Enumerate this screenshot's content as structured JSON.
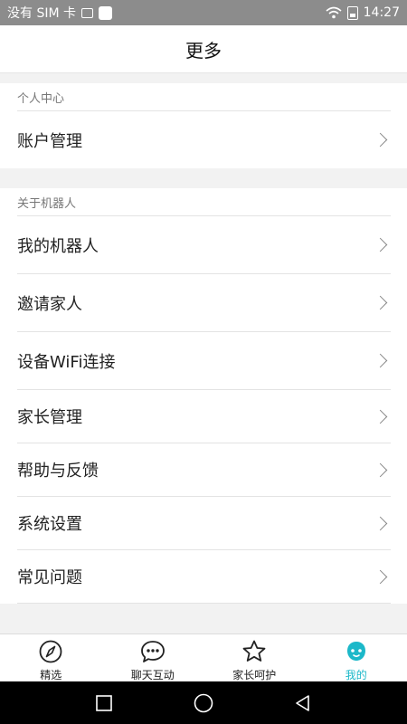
{
  "status_bar": {
    "carrier": "没有 SIM 卡",
    "time": "14:27"
  },
  "header": {
    "title": "更多"
  },
  "sections": [
    {
      "heading": "个人中心",
      "items": [
        {
          "label": "账户管理"
        }
      ]
    },
    {
      "heading": "关于机器人",
      "items": [
        {
          "label": "我的机器人"
        },
        {
          "label": "邀请家人"
        },
        {
          "label": "设备WiFi连接"
        },
        {
          "label": "家长管理"
        },
        {
          "label": "帮助与反馈"
        },
        {
          "label": "系统设置"
        },
        {
          "label": "常见问题"
        }
      ]
    }
  ],
  "tabs": [
    {
      "label": "精选",
      "icon": "compass-icon"
    },
    {
      "label": "聊天互动",
      "icon": "chat-bubble-icon"
    },
    {
      "label": "家长呵护",
      "icon": "star-icon"
    },
    {
      "label": "我的",
      "icon": "robot-face-icon",
      "active": true
    }
  ],
  "colors": {
    "accent": "#1cb8c9",
    "status_bar": "#8c8c8c"
  }
}
